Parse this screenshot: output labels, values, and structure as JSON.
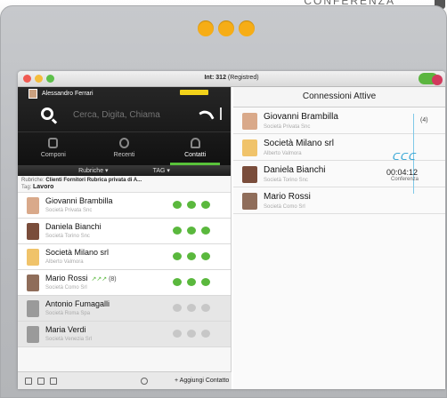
{
  "header": {
    "corner_word": "CONFERENZA"
  },
  "window": {
    "title_prefix": "Int: 312",
    "title_suffix": "(Registred)"
  },
  "user": {
    "name": "Alessandro Ferrari"
  },
  "search": {
    "placeholder": "Cerca, Digita, Chiama"
  },
  "nav": {
    "tabs": [
      "Componi",
      "Recenti",
      "Contatti"
    ],
    "active": "Contatti"
  },
  "filters": {
    "rubriche": "Rubriche",
    "tag": "TAG"
  },
  "breadcrumb": {
    "label": "Rubriche:",
    "items": [
      "Clienti",
      "Fornitori",
      "Rubrica privata di A..."
    ]
  },
  "tag_line": {
    "label": "Tag:",
    "value": "Lavoro"
  },
  "contacts": [
    {
      "name": "Giovanni Brambilla",
      "company": "Società Privata Snc",
      "status": "online",
      "color": "#d9a98a"
    },
    {
      "name": "Daniela Bianchi",
      "company": "Società Torino Snc",
      "status": "online",
      "color": "#7a4d3b"
    },
    {
      "name": "Società Milano srl",
      "company": "Alberto Valmora",
      "status": "online",
      "color": "#f0c36a"
    },
    {
      "name": "Mario Rossi",
      "company": "Società Como Srl",
      "status": "online",
      "color": "#8f6d5a",
      "extra": "(8)"
    },
    {
      "name": "Antonio Fumagalli",
      "company": "Società Roma Spa",
      "status": "offline",
      "color": "#9a9a9a"
    },
    {
      "name": "Maria Verdi",
      "company": "Società Venezia Srl",
      "status": "offline",
      "color": "#9a9a9a"
    }
  ],
  "bottom": {
    "add_label": "Aggiungi Contatto"
  },
  "connections": {
    "title": "Connessioni Attive",
    "count": "(4)",
    "timer": "00:04:12",
    "timer_label": "Conferenza",
    "parties": [
      {
        "name": "Giovanni Brambilla",
        "company": "Società Privata Snc",
        "color": "#d9a98a"
      },
      {
        "name": "Società Milano srl",
        "company": "Alberto Valmora",
        "color": "#f0c36a"
      },
      {
        "name": "Daniela Bianchi",
        "company": "Società Torino Snc",
        "color": "#7a4d3b"
      },
      {
        "name": "Mario Rossi",
        "company": "Società Como Srl",
        "color": "#8f6d5a"
      }
    ]
  },
  "colors": {
    "accent_green": "#5ab83d",
    "accent_orange": "#f6ad16",
    "accent_blue": "#29a1d4"
  }
}
